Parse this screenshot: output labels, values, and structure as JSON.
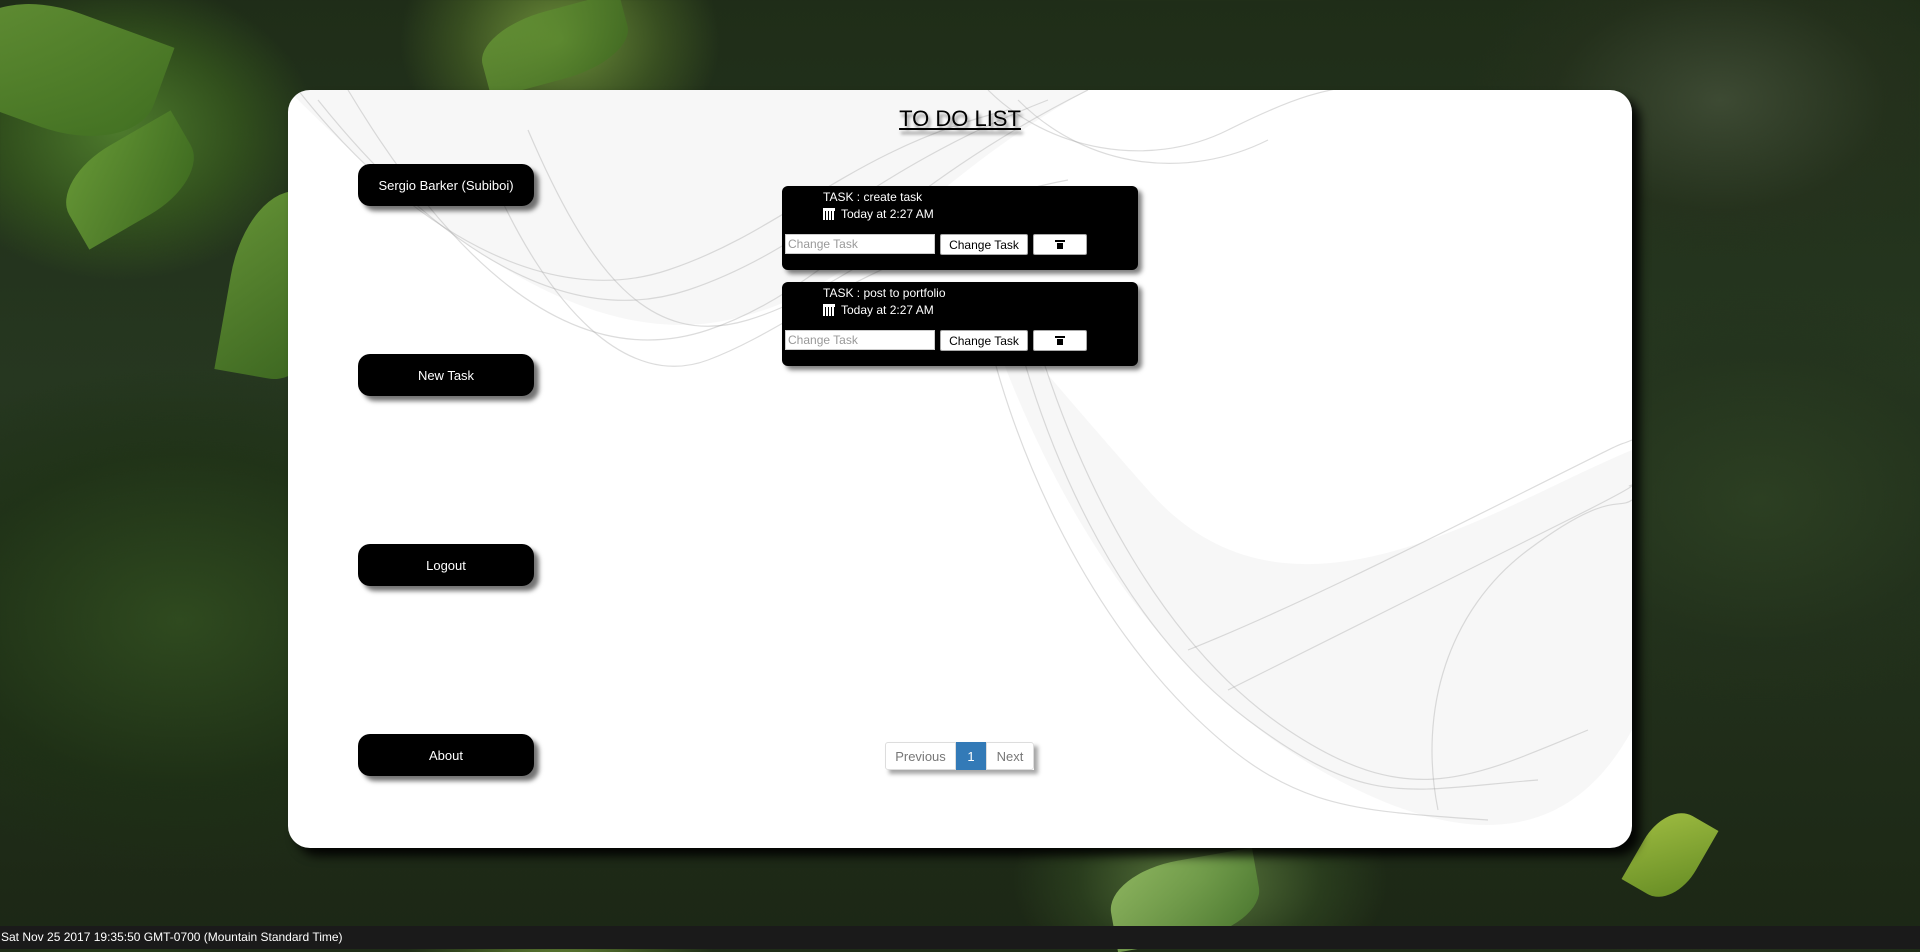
{
  "page": {
    "title": "TO DO LIST"
  },
  "sidebar": {
    "user_label": "Sergio Barker (Subiboi)",
    "new_task_label": "New Task",
    "logout_label": "Logout",
    "about_label": "About"
  },
  "tasks": [
    {
      "name": "TASK : create task",
      "date": "Today at 2:27 AM",
      "input_placeholder": "Change Task",
      "change_label": "Change Task",
      "delete_icon": "trash-icon"
    },
    {
      "name": "TASK : post to portfolio",
      "date": "Today at 2:27 AM",
      "input_placeholder": "Change Task",
      "change_label": "Change Task",
      "delete_icon": "trash-icon"
    }
  ],
  "pagination": {
    "previous_label": "Previous",
    "current_page": "1",
    "next_label": "Next"
  },
  "status_bar": {
    "text": "Sat Nov 25 2017 19:35:50 GMT-0700 (Mountain Standard Time)"
  },
  "colors": {
    "panel_bg": "#ffffff",
    "button_bg": "#000000",
    "page_active": "#337ab7",
    "status_bar_bg": "#1a1a1a"
  }
}
